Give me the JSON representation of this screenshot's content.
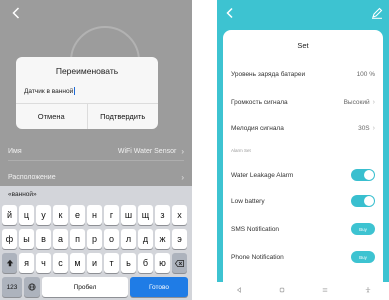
{
  "left": {
    "dialog": {
      "title": "Переименовать",
      "input_value": "Датчик в ванной",
      "cancel_label": "Отмена",
      "confirm_label": "Подтвердить"
    },
    "rows": [
      {
        "label": "Имя",
        "value": "WiFi Water Sensor"
      },
      {
        "label": "Расположение",
        "value": ""
      }
    ],
    "keyboard": {
      "suggestion": "«ванной»",
      "row1": [
        "й",
        "ц",
        "у",
        "к",
        "е",
        "н",
        "г",
        "ш",
        "щ",
        "з",
        "х"
      ],
      "row2": [
        "ф",
        "ы",
        "в",
        "а",
        "п",
        "р",
        "о",
        "л",
        "д",
        "ж",
        "э"
      ],
      "row3": [
        "я",
        "ч",
        "с",
        "м",
        "и",
        "т",
        "ь",
        "б",
        "ю"
      ],
      "numbers_key": "123",
      "space_label": "Пробел",
      "go_label": "Готово"
    }
  },
  "right": {
    "title": "Set",
    "rows": [
      {
        "label": "Уровень заряда батареи",
        "value": "100 %"
      },
      {
        "label": "Громкость сигнала",
        "value": "Высокий"
      },
      {
        "label": "Мелодия сигнала",
        "value": "30S"
      }
    ],
    "alarm_caption": "Alarm Set",
    "toggles": [
      {
        "label": "Water Leakage Alarm",
        "on": true
      },
      {
        "label": "Low battery",
        "on": true
      }
    ],
    "notifications": [
      {
        "label": "SMS Notification",
        "button": "Buy"
      },
      {
        "label": "Phone Notification",
        "button": "Buy"
      }
    ],
    "accent_color": "#3dc3d1"
  }
}
